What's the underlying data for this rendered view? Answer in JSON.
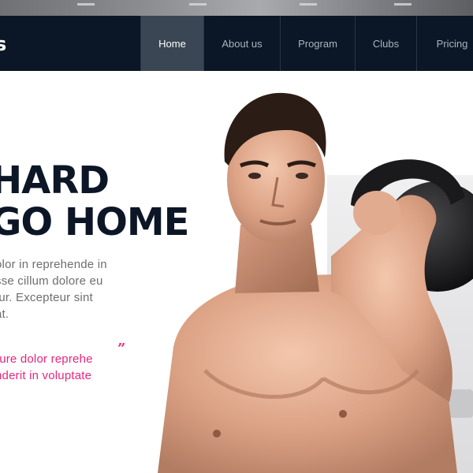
{
  "nav": {
    "logo_fragment": "s",
    "items": [
      {
        "label": "Home",
        "active": true
      },
      {
        "label": "About us",
        "active": false
      },
      {
        "label": "Program",
        "active": false
      },
      {
        "label": "Clubs",
        "active": false
      },
      {
        "label": "Pricing",
        "active": false
      }
    ]
  },
  "hero": {
    "title_line_1": "HARD",
    "title_line_2": "GO HOME",
    "paragraph_lines": [
      "olor in reprehende in",
      "sse cillum dolore eu",
      "tur. Excepteur sint",
      "at."
    ],
    "quote_lines": [
      "rure dolor reprehe",
      "nderit in voluptate"
    ],
    "quote_mark": "”"
  },
  "image": {
    "subject": "athlete-with-kettlebell"
  },
  "colors": {
    "nav_bg": "#0b1726",
    "nav_active_bg": "#3a4654",
    "title": "#0c1626",
    "accent": "#e8267d",
    "body_text": "#6e6e6e"
  }
}
